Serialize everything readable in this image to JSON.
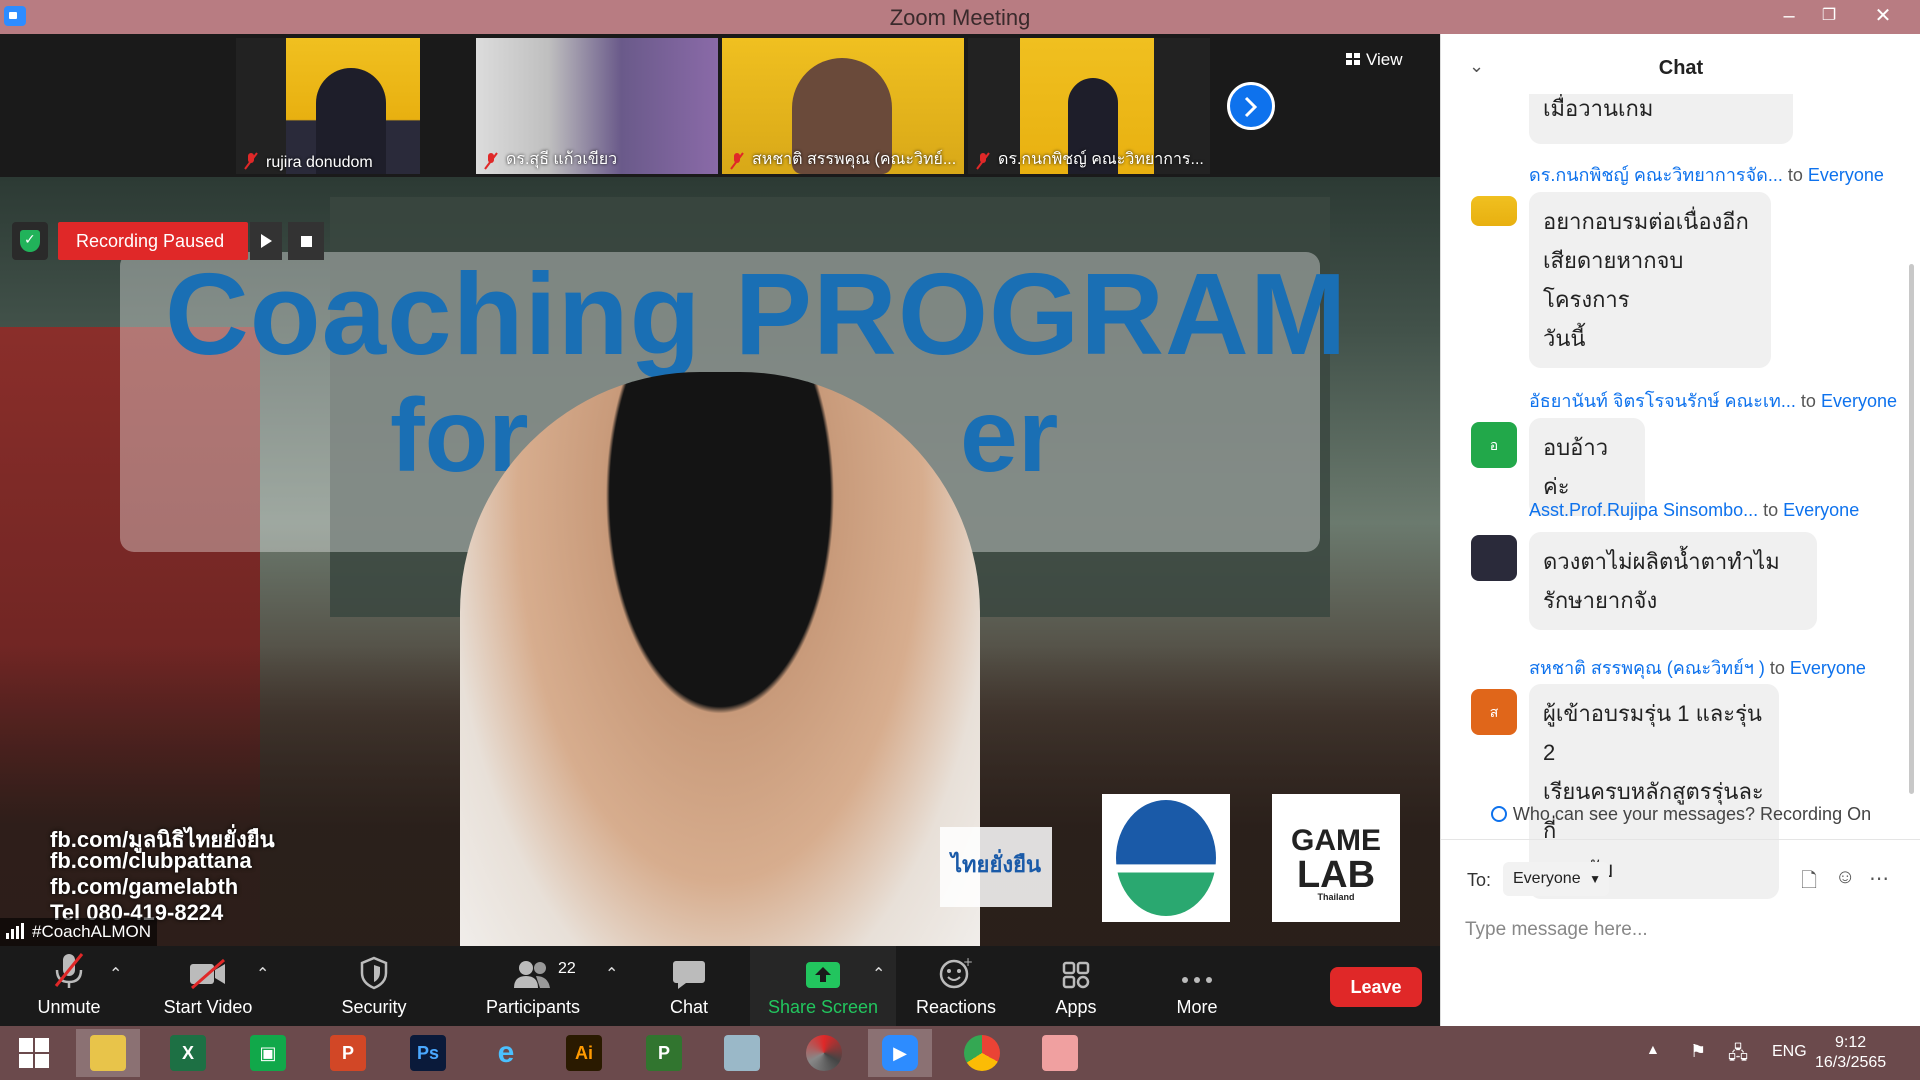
{
  "window": {
    "title": "Zoom Meeting",
    "controls": [
      "–",
      "❐",
      "✕"
    ]
  },
  "thumbnails": [
    {
      "name": "rujira donudom",
      "muted": true
    },
    {
      "name": "ดร.สุธี  แก้วเขียว",
      "muted": true
    },
    {
      "name": "สหชาติ สรรพคุณ (คณะวิทย์...",
      "muted": true
    },
    {
      "name": "ดร.กนกพิชญ์ คณะวิทยาการ...",
      "muted": true
    }
  ],
  "view_button": "View",
  "recording": {
    "status": "Recording Paused"
  },
  "slide": {
    "title_line1": "Coaching PROGRAM",
    "title_line2_left": "for",
    "title_line2_right": "er",
    "links": [
      "fb.com/มูลนิธิไทยยั่งยืน",
      "fb.com/clubpattana",
      "fb.com/gamelabth",
      "Tel 080-419-8224"
    ],
    "logo1": "ไทยยั่งยืน",
    "logo3_line1": "GAME",
    "logo3_line2": "LAB",
    "logo3_line3": "Thailand"
  },
  "speaker_name": "#CoachALMON",
  "toolbar": {
    "unmute": "Unmute",
    "start_video": "Start Video",
    "security": "Security",
    "participants": "Participants",
    "participants_count": "22",
    "chat": "Chat",
    "share_screen": "Share Screen",
    "reactions": "Reactions",
    "apps": "Apps",
    "more": "More",
    "leave": "Leave"
  },
  "chat": {
    "title": "Chat",
    "partial_message": "เมื่อวานเกม",
    "messages": [
      {
        "sender": "ดร.กนกพิชญ์ คณะวิทยาการจัด...",
        "to": "to",
        "recipient": "Everyone",
        "lines": [
          "อยากอบรมต่อเนื่องอีก",
          "เสียดายหากจบโครงการ",
          "วันนี้"
        ],
        "avatar_text": ""
      },
      {
        "sender": "อัธยานันท์ จิตรโรจนรักษ์ คณะเท...",
        "to": "to",
        "recipient": "Everyone",
        "lines": [
          "อบอ้าวค่ะ"
        ],
        "avatar_text": "อ"
      },
      {
        "sender": "Asst.Prof.Rujipa Sinsombo...",
        "to": "to",
        "recipient": "Everyone",
        "lines": [
          "ดวงตาไม่ผลิตน้ำตาทำไม",
          "รักษายากจัง"
        ],
        "avatar_text": ""
      },
      {
        "sender": "สหชาติ สรรพคุณ (คณะวิทย์ฯ )",
        "to": "to",
        "recipient": "Everyone",
        "lines": [
          "ผู้เข้าอบรมรุ่น 1 และรุ่น 2",
          "เรียนครบหลักสูตรรุ่นละกี่",
          "คนครับ"
        ],
        "avatar_text": "ส"
      }
    ],
    "who_can_see": "Who can see your messages? Recording On",
    "to_label": "To:",
    "to_value": "Everyone",
    "input_placeholder": "Type message here..."
  },
  "taskbar": {
    "apps": [
      "start",
      "file-explorer",
      "excel",
      "store",
      "powerpoint",
      "photoshop",
      "internet-explorer",
      "illustrator",
      "project",
      "pen",
      "photoscape",
      "zoom",
      "chrome",
      "paint"
    ],
    "lang": "ENG",
    "time": "9:12",
    "date": "16/3/2565"
  },
  "colors": {
    "titlebar": "#b87c82",
    "accent": "#0e72ed",
    "recording": "#e02828",
    "share": "#22c55e",
    "taskbar": "#6b4a4c"
  }
}
